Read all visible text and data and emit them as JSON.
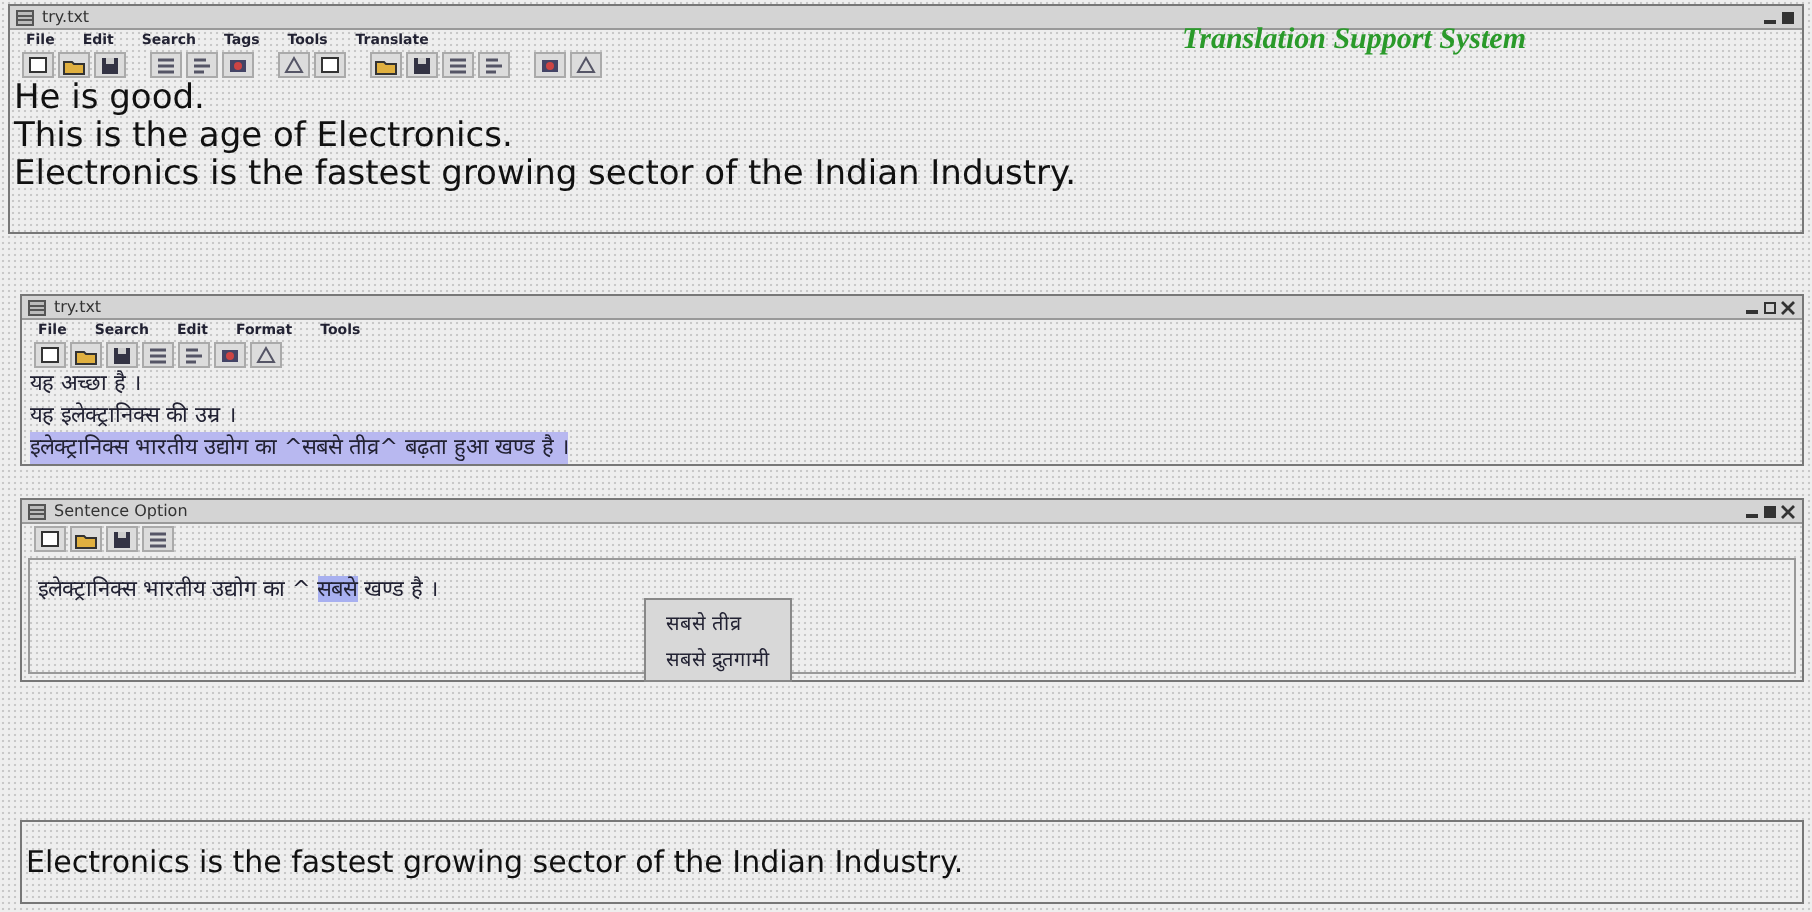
{
  "main_window": {
    "title": "try.txt",
    "menu": [
      "File",
      "Edit",
      "Search",
      "Tags",
      "Tools",
      "Translate"
    ],
    "banner": "Translation Support System",
    "lines": [
      "He is good.",
      "This is the age of Electronics.",
      "Electronics is the fastest growing sector of the Indian Industry."
    ]
  },
  "translation_window": {
    "title": "try.txt",
    "menu": [
      "File",
      "Search",
      "Edit",
      "Format",
      "Tools"
    ],
    "lines": [
      {
        "text": "यह अच्छा है ।",
        "selected": false
      },
      {
        "text": "यह इलेक्ट्रानिक्स की उम्र ।",
        "selected": false
      },
      {
        "text": "इलेक्ट्रानिक्स भारतीय उद्योग का ^सबसे तीव्र^ बढ़ता हुआ खण्ड है ।",
        "selected": true
      }
    ]
  },
  "sentence_option": {
    "title": "Sentence Option",
    "segments": [
      {
        "text": "इलेक्ट्रानिक्स भारतीय उद्योग का ^ ",
        "selected": false
      },
      {
        "text": "सबसे",
        "selected": true
      },
      {
        "text": " खण्ड है ।",
        "selected": false
      }
    ],
    "popup": [
      {
        "text": "सबसे तीव्र",
        "selected": false
      },
      {
        "text": "सबसे द्रुतगामी",
        "selected": false
      }
    ]
  },
  "output_line": "Electronics is the fastest growing sector of the Indian Industry."
}
